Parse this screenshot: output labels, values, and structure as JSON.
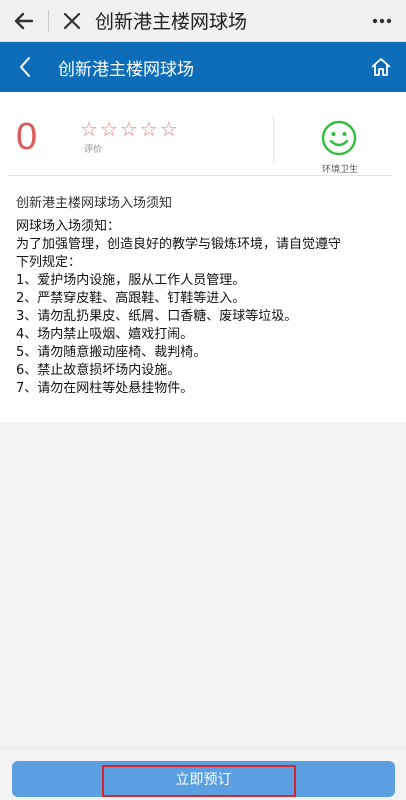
{
  "browser": {
    "title": "创新港主楼网球场"
  },
  "header": {
    "title": "创新港主楼网球场"
  },
  "rating": {
    "score": "0",
    "stars_total": 5,
    "stars_filled": 0,
    "label": "评价",
    "hygiene_label": "环境卫生"
  },
  "notice": {
    "title": "创新港主楼网球场入场须知",
    "lines": [
      "网球场入场须知：",
      "为了加强管理，创造良好的教学与锻炼环境，请自觉遵守",
      "下列规定：",
      "1、爱护场内设施，服从工作人员管理。",
      "2、严禁穿皮鞋、高跟鞋、钉鞋等进入。",
      "3、请勿乱扔果皮、纸屑、口香糖、废球等垃圾。",
      "4、场内禁止吸烟、嬉戏打闹。",
      "5、请勿随意搬动座椅、裁判椅。",
      "6、禁止故意损坏场内设施。",
      "7、请勿在网柱等处悬挂物件。"
    ]
  },
  "actions": {
    "book_label": "立即预订"
  },
  "colors": {
    "header_blue": "#0e6db8",
    "score_red": "#e05a5a",
    "smiley_green": "#2fbf3a",
    "button_blue": "#5b9fe0",
    "highlight_red": "#d9262c"
  }
}
